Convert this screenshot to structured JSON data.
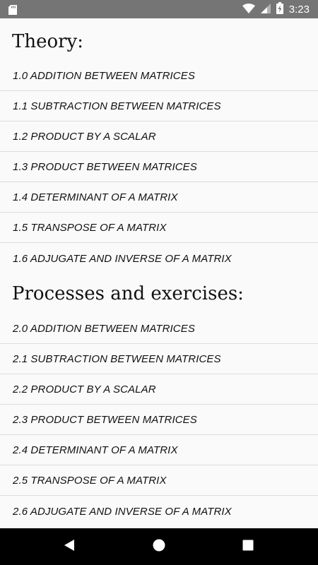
{
  "status_bar": {
    "time": "3:23",
    "icons": [
      "sd-card-icon",
      "wifi-icon",
      "signal-icon",
      "battery-charging-icon"
    ]
  },
  "sections": [
    {
      "title": "Theory:",
      "items": [
        "1.0 ADDITION BETWEEN MATRICES",
        "1.1 SUBTRACTION BETWEEN MATRICES",
        "1.2 PRODUCT BY A SCALAR",
        "1.3 PRODUCT BETWEEN MATRICES",
        "1.4 DETERMINANT OF A MATRIX",
        "1.5 TRANSPOSE OF A MATRIX",
        "1.6 ADJUGATE AND INVERSE OF A MATRIX"
      ]
    },
    {
      "title": "Processes and exercises:",
      "items": [
        "2.0 ADDITION BETWEEN MATRICES",
        "2.1 SUBTRACTION BETWEEN MATRICES",
        "2.2 PRODUCT BY A SCALAR",
        "2.3 PRODUCT BETWEEN MATRICES",
        "2.4 DETERMINANT OF A MATRIX",
        "2.5 TRANSPOSE OF A MATRIX",
        "2.6 ADJUGATE AND INVERSE OF A MATRIX"
      ]
    }
  ],
  "nav_bar": {
    "icons": [
      "back-icon",
      "home-icon",
      "recents-icon"
    ]
  },
  "colors": {
    "status_bar": "#757575",
    "background": "#fafafa",
    "divider": "#dddddd",
    "nav_bar": "#000000"
  }
}
